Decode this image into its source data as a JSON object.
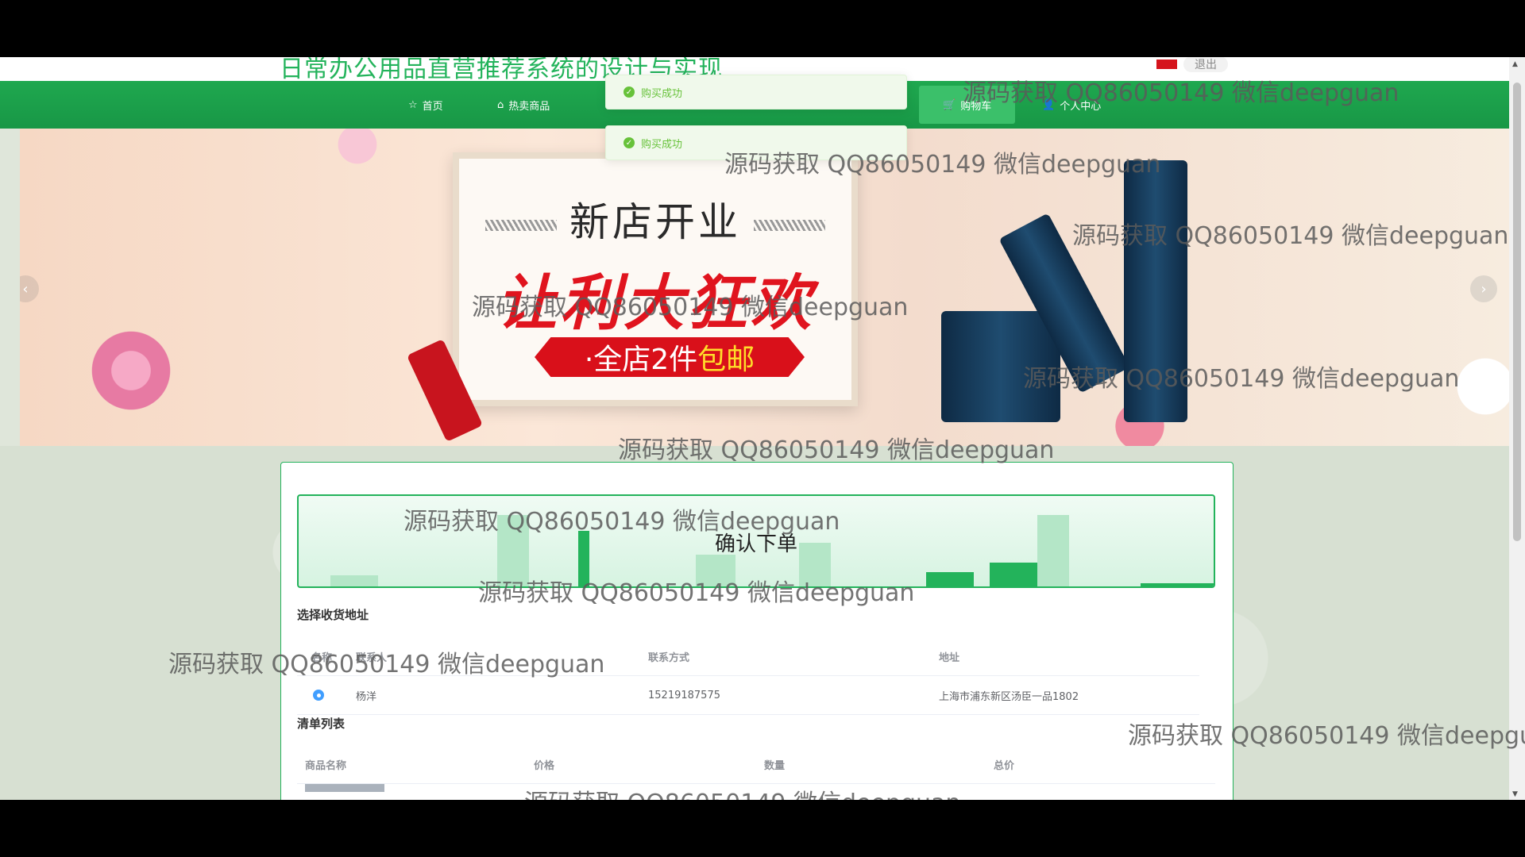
{
  "site": {
    "title": "日常办公用品直营推荐系统的设计与实现",
    "logout_label": "退出"
  },
  "nav": {
    "items": [
      {
        "icon": "☆",
        "label": "首页"
      },
      {
        "icon": "⌂",
        "label": "热卖商品"
      },
      {
        "icon": "🛒",
        "label": "购物车"
      },
      {
        "icon": "👤",
        "label": "个人中心"
      }
    ]
  },
  "toasts": [
    {
      "text": "购买成功"
    },
    {
      "text": "购买成功"
    }
  ],
  "banner": {
    "line1": "新店开业",
    "line2": "让利大狂欢",
    "line3_prefix": "·全店2件",
    "line3_highlight": "包邮",
    "prev_arrow": "‹",
    "next_arrow": "›"
  },
  "order": {
    "title": "确认下单",
    "address_section_label": "选择收货地址",
    "address_headers": [
      "名称",
      "联系人",
      "联系方式",
      "地址"
    ],
    "address_rows": [
      {
        "name": "杨洋",
        "phone": "15219187575",
        "address": "上海市浦东新区汤臣一品1802"
      }
    ],
    "items_section_label": "清单列表",
    "item_headers": [
      "商品名称",
      "价格",
      "数量",
      "总价"
    ]
  },
  "watermark": "源码获取 QQ86050149 微信deepguan",
  "watermark_cut": "源码获取 QQ86050149 微信deepgu",
  "colors": {
    "brand_green": "#23b35b",
    "nav_green": "#1fa84f",
    "toast_green": "#67c23a",
    "radio_blue": "#409eff"
  }
}
